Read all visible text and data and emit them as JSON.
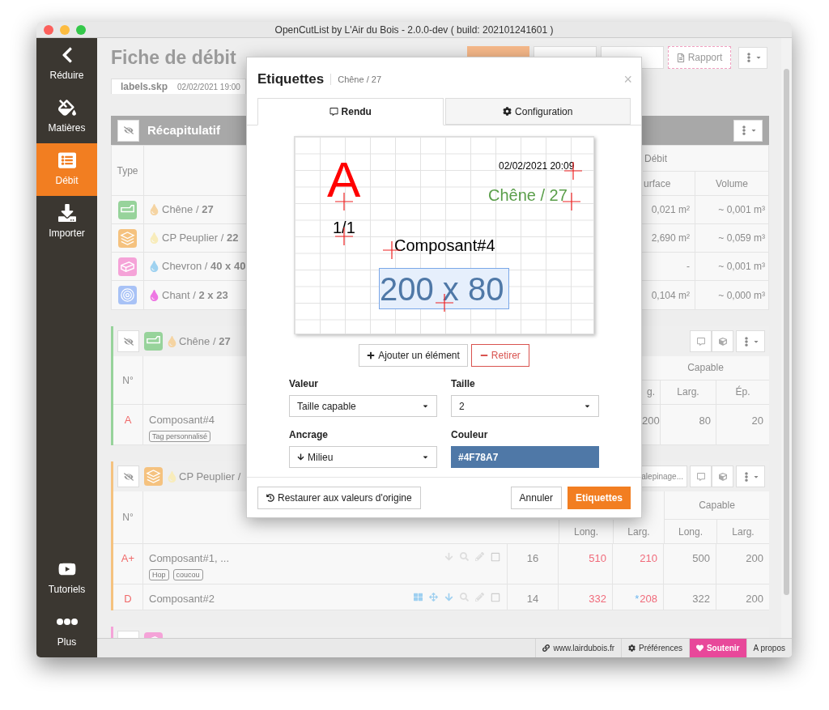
{
  "window": {
    "title": "OpenCutList by L'Air du Bois - 2.0.0-dev ( build: 202101241601 )"
  },
  "sidebar": {
    "items": [
      {
        "kind": "back",
        "label": "Réduire",
        "selected": false
      },
      {
        "kind": "materials",
        "label": "Matières",
        "selected": false
      },
      {
        "kind": "cutlist",
        "label": "Débit",
        "selected": true
      },
      {
        "kind": "import",
        "label": "Importer",
        "selected": false
      }
    ],
    "bottom_items": [
      {
        "kind": "video",
        "label": "Tutoriels",
        "selected": false
      },
      {
        "kind": "more",
        "label": "Plus",
        "selected": false
      }
    ]
  },
  "header": {
    "title": "Fiche de débit",
    "report_button": "Rapport"
  },
  "file_tab": {
    "filename": "labels.skp",
    "date": "02/02/2021 19:00"
  },
  "summary": {
    "title": "Récapitulatif",
    "type_header": "Type",
    "debit_header": "Débit",
    "surface_header": "urface",
    "volume_header": "Volume",
    "rows": [
      {
        "kind": "solid",
        "color": "#97d39b",
        "wood": {
          "color": "#f5d4a2"
        },
        "name": "Chêne / **27**",
        "surface": "0,021 m²",
        "volume": "~ 0,001 m³"
      },
      {
        "kind": "sheet",
        "color": "#f5c27f",
        "wood": {
          "color": "#f8ecbb"
        },
        "name": "CP Peuplier / **22**",
        "surface": "2,690 m²",
        "volume": "~ 0,059 m³"
      },
      {
        "kind": "bar",
        "color": "#f5a3d8",
        "wood": {
          "color": "#9fd2f0"
        },
        "name": "Chevron / **40 x 40**",
        "surface": "-",
        "volume": "~ 0,001 m³"
      },
      {
        "kind": "edge",
        "color": "#a8c2f6",
        "wood": {
          "color": "#ee77e3"
        },
        "name": "Chant / **2 x 23**",
        "surface": "0,104 m²",
        "volume": "~ 0,000 m³"
      }
    ]
  },
  "groups": [
    {
      "kind": "solid",
      "color": "#97d39b",
      "wood": {
        "color": "#f5d4a2"
      },
      "title": "Chêne / **27**",
      "number_header": "N°",
      "capable_header": "Capable",
      "subheaders": [
        "g.",
        "Larg.",
        "Ép."
      ],
      "rows": [
        {
          "number": "A",
          "name": "Composant#4",
          "tags": [
            "Tag personnalisé"
          ],
          "values": [
            "200",
            "80",
            "20"
          ]
        }
      ]
    },
    {
      "kind": "sheet",
      "color": "#f5c27f",
      "wood": {
        "color": "#f8ecbb"
      },
      "title": "CP Peuplier /",
      "calepinage_button": "alepinage...",
      "number_header": "N°",
      "capable_header": "Capable",
      "subheaders": [
        "Long.",
        "Larg.",
        "Long.",
        "Larg."
      ],
      "rows": [
        {
          "number": "A+",
          "name": "Composant#1, ...",
          "tags": [
            "Hop",
            "coucou"
          ],
          "flagged": false,
          "checked": false,
          "qty": "16",
          "values": [
            {
              "text": "510",
              "highlight": true
            },
            {
              "text": "210",
              "highlight": true
            },
            {
              "text": "500",
              "highlight": false
            },
            {
              "text": "200",
              "highlight": false
            }
          ]
        },
        {
          "number": "D",
          "name": "Composant#2",
          "flagged": true,
          "checked": false,
          "qty": "14",
          "values": [
            {
              "text": "332",
              "highlight": true
            },
            {
              "text": "208",
              "highlight": true,
              "marker": "*"
            },
            {
              "text": "322",
              "highlight": false
            },
            {
              "text": "200",
              "highlight": false
            }
          ]
        }
      ]
    },
    {
      "kind": "bar",
      "color": "#f5a3d8"
    }
  ],
  "footer": {
    "links": [
      {
        "kind": "link",
        "label": "www.lairdubois.fr"
      },
      {
        "kind": "settings",
        "label": "Préférences"
      },
      {
        "kind": "support",
        "label": "Soutenir"
      },
      {
        "kind": "plain",
        "label": "A propos"
      }
    ]
  },
  "modal": {
    "title": "Etiquettes",
    "subtitle": "Chêne / 27",
    "close": "×",
    "tabs": [
      {
        "kind": "render",
        "label": "Rendu",
        "selected": true
      },
      {
        "kind": "config",
        "label": "Configuration",
        "selected": false
      }
    ],
    "preview": {
      "elements": [
        {
          "text": "A",
          "color": "#ff0000",
          "selected": false
        },
        {
          "text": "1/1",
          "color": "#000000",
          "selected": false
        },
        {
          "text": "02/02/2021 20:09",
          "color": "#000000",
          "selected": false
        },
        {
          "text": "Chêne / 27",
          "color": "#5a9e4a",
          "selected": false
        },
        {
          "text": "Composant#4",
          "color": "#000000",
          "selected": false
        },
        {
          "text": "200 x 80",
          "color": "#4f78a7",
          "selected": true
        }
      ]
    },
    "add_button": "Ajouter un élément",
    "remove_button": "Retirer",
    "fields": [
      {
        "kind": "select",
        "label": "Valeur",
        "value": "Taille capable"
      },
      {
        "kind": "select",
        "label": "Taille",
        "value": "2"
      },
      {
        "kind": "anchor",
        "label": "Ancrage",
        "value": "Milieu"
      },
      {
        "kind": "color",
        "label": "Couleur",
        "value": "#4F78A7"
      }
    ],
    "reset_button": "Restaurer aux valeurs d'origine",
    "cancel_button": "Annuler",
    "confirm_button": "Etiquettes"
  }
}
